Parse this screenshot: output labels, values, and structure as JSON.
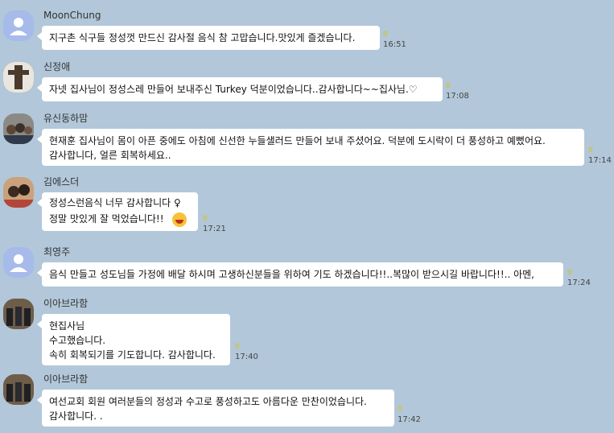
{
  "messages": [
    {
      "name": "MoonChung",
      "lines": [
        "지구촌 식구들 정성껏 만드신 감사절 음식 참 고맙습니다.맛있게 즐겠습니다."
      ],
      "count": "0",
      "time": "16:51"
    },
    {
      "name": "신정애",
      "lines": [
        "자넷 집사님이  정성스레 만들어 보내주신 Turkey 덕분이었습니다..감사합니다~~집사님.♡"
      ],
      "count": "0",
      "time": "17:08"
    },
    {
      "name": "유신동하맘",
      "lines": [
        "현재훈 집사님이 몸이 아픈 중에도 아침에 신선한 누들샐러드 만들어 보내 주셨어요. 덕분에 도시락이 더 풍성하고 예뻤어요.",
        "감사합니다, 얼른 회복하세요.."
      ],
      "count": "0",
      "time": "17:14"
    },
    {
      "name": "김에스더",
      "lines": [
        "정성스런음식 너무 감사합니다 ♀",
        "정말 맛있게 잘 먹었습니다!!"
      ],
      "count": "0",
      "time": "17:21"
    },
    {
      "name": "최영주",
      "lines": [
        "음식 만들고 성도님들 가정에 배달 하시며 고생하신분들을 위하여 기도 하겠습니다!!..복많이 받으시길 바랍니다!!.. 아멘,"
      ],
      "count": "0",
      "time": "17:24"
    },
    {
      "name": "이아브라함",
      "lines": [
        "현집사님",
        "수고했습니다.",
        "속히 회복되기를 기도합니다. 감사합니다."
      ],
      "count": "0",
      "time": "17:40"
    },
    {
      "name": "이아브라함",
      "lines": [
        "여선교회 회원 여러분들의 정성과 수고로 풍성하고도 아름다운 만찬이었습니다.",
        "감사합니다. ."
      ],
      "count": "0",
      "time": "17:42"
    }
  ],
  "colors": {
    "background": "#b2c7d9",
    "bubble": "#ffffff",
    "unread": "#d8c400"
  }
}
